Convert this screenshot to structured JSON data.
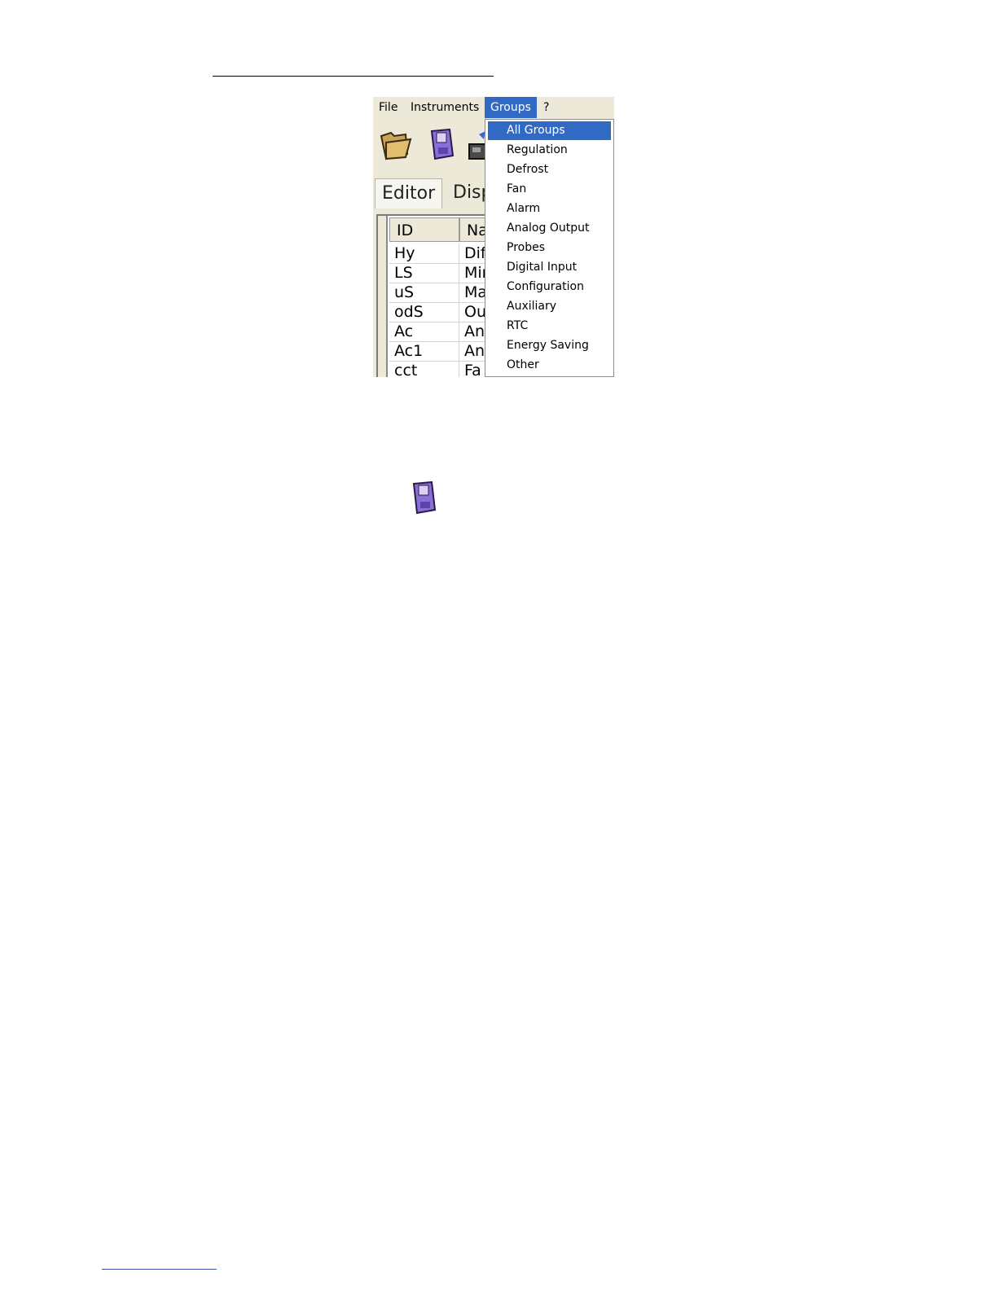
{
  "menubar": {
    "items": [
      "File",
      "Instruments",
      "Groups",
      "?"
    ],
    "active": "Groups"
  },
  "toolbar": {
    "icons": [
      "open-folder-icon",
      "save-disk-icon",
      "device-icon"
    ]
  },
  "tabs": [
    "Editor",
    "Disp"
  ],
  "grid": {
    "columns": [
      "ID",
      "Na"
    ],
    "rows": [
      [
        "Hy",
        "Dif"
      ],
      [
        "LS",
        "Mir"
      ],
      [
        "uS",
        "Ma"
      ],
      [
        "odS",
        "Ou"
      ],
      [
        "Ac",
        "An"
      ],
      [
        "Ac1",
        "An"
      ],
      [
        "cct",
        "Fa"
      ]
    ]
  },
  "groups_menu": {
    "items": [
      "All Groups",
      "Regulation",
      "Defrost",
      "Fan",
      "Alarm",
      "Analog Output",
      "Probes",
      "Digital Input",
      "Configuration",
      "Auxiliary",
      "RTC",
      "Energy Saving",
      "Other"
    ],
    "highlighted": "All Groups"
  },
  "colors": {
    "selection": "#316ac5",
    "chrome": "#ece9d8",
    "disk_purple": "#8b6fd6"
  }
}
